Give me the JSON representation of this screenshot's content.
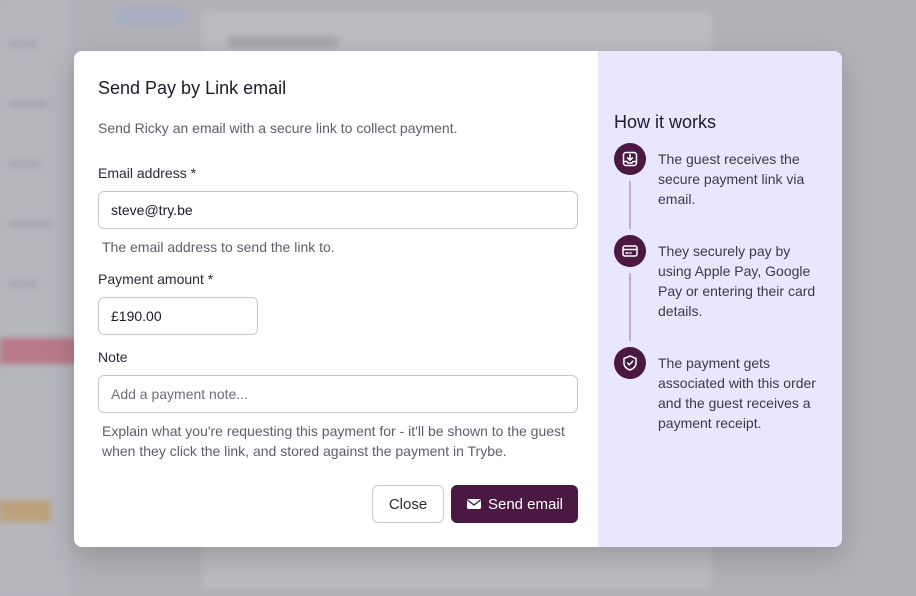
{
  "modal": {
    "title": "Send Pay by Link email",
    "subtitle": "Send Ricky an email with a secure link to collect payment.",
    "email": {
      "label": "Email address",
      "required_marker": "*",
      "value": "steve@try.be",
      "help": "The email address to send the link to."
    },
    "amount": {
      "label": "Payment amount",
      "required_marker": "*",
      "value": "£190.00"
    },
    "note": {
      "label": "Note",
      "placeholder": "Add a payment note...",
      "help": "Explain what you're requesting this payment for - it'll be shown to the guest when they click the link, and stored against the payment in Trybe."
    },
    "buttons": {
      "close_label": "Close",
      "send_label": "Send email"
    }
  },
  "how_it_works": {
    "title": "How it works",
    "steps": [
      {
        "icon": "inbox-download-icon",
        "text": "The guest receives the secure payment link via email."
      },
      {
        "icon": "credit-card-icon",
        "text": "They securely pay by using Apple Pay, Google Pay or entering their card details."
      },
      {
        "icon": "shield-check-icon",
        "text": "The payment gets associated with this order and the guest receives a payment receipt."
      }
    ]
  },
  "colors": {
    "accent": "#4a1842",
    "side_panel_bg": "#e8e7fd",
    "step_line": "#c9a7c7"
  }
}
